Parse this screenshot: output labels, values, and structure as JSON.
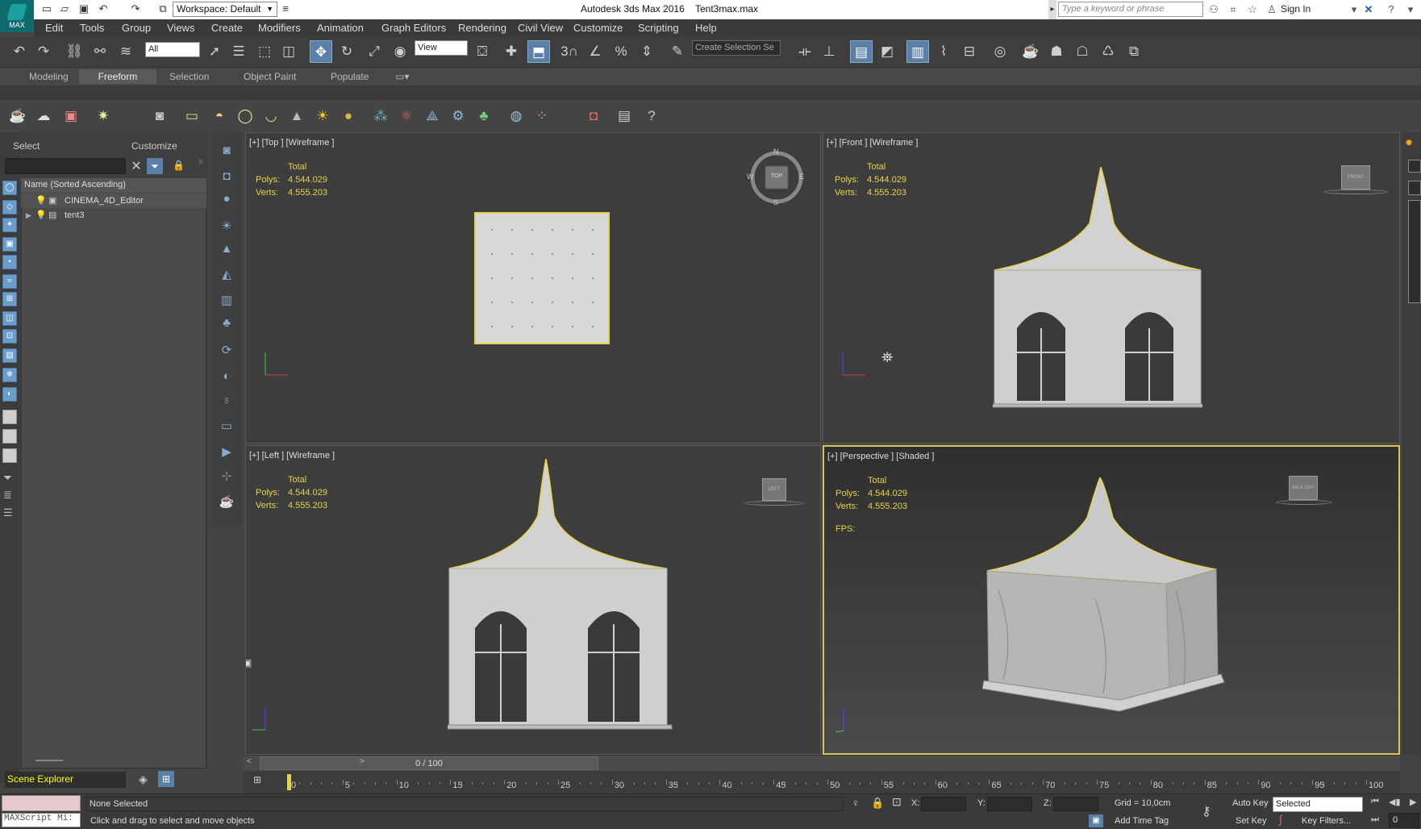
{
  "app": {
    "logo_label": "MAX",
    "title": "Autodesk 3ds Max 2016",
    "file": "Tent3max.max",
    "workspace": "Workspace: Default",
    "search_placeholder": "Type a keyword or phrase",
    "sign_in": "Sign In"
  },
  "menus": [
    "Edit",
    "Tools",
    "Group",
    "Views",
    "Create",
    "Modifiers",
    "Animation",
    "Graph Editors",
    "Rendering",
    "Civil View",
    "Customize",
    "Scripting",
    "Help"
  ],
  "toolbar": {
    "filter_value": "All",
    "refcoord_value": "View",
    "selection_set_placeholder": "Create Selection Se",
    "snap_value": "3"
  },
  "ribbon_tabs": [
    {
      "label": "Modeling",
      "active": false
    },
    {
      "label": "Freeform",
      "active": true
    },
    {
      "label": "Selection",
      "active": false
    },
    {
      "label": "Object Paint",
      "active": false
    },
    {
      "label": "Populate",
      "active": false
    }
  ],
  "scene_explorer": {
    "select_tab": "Select",
    "customize_tab": "Customize",
    "column_header": "Name (Sorted Ascending)",
    "items": [
      {
        "label": "CINEMA_4D_Editor",
        "expanded": false
      },
      {
        "label": "tent3",
        "expanded": false
      }
    ],
    "footer_label": "Scene Explorer"
  },
  "viewports": {
    "top": {
      "label": "[+] [Top ] [Wireframe ]",
      "total": "Total",
      "polys_label": "Polys:",
      "polys": "4.544.029",
      "verts_label": "Verts:",
      "verts": "4.555.203",
      "cube_label": "TOP",
      "compass": [
        "N",
        "E",
        "S",
        "W"
      ]
    },
    "front": {
      "label": "[+] [Front ] [Wireframe ]",
      "total": "Total",
      "polys_label": "Polys:",
      "polys": "4.544.029",
      "verts_label": "Verts:",
      "verts": "4.555.203",
      "cube_label": "FRONT"
    },
    "left": {
      "label": "[+] [Left ] [Wireframe ]",
      "total": "Total",
      "polys_label": "Polys:",
      "polys": "4.544.029",
      "verts_label": "Verts:",
      "verts": "4.555.203",
      "cube_label": "LEFT"
    },
    "perspective": {
      "label": "[+] [Perspective ] [Shaded ]",
      "total": "Total",
      "polys_label": "Polys:",
      "polys": "4.544.029",
      "verts_label": "Verts:",
      "verts": "4.555.203",
      "fps_label": "FPS:",
      "cube_label": "BACK LEFT"
    }
  },
  "timeline": {
    "frame_display": "0 / 100",
    "ticks": [
      "0",
      "5",
      "10",
      "15",
      "20",
      "25",
      "30",
      "35",
      "40",
      "45",
      "50",
      "55",
      "60",
      "65",
      "70",
      "75",
      "80",
      "85",
      "90",
      "95",
      "100"
    ]
  },
  "status": {
    "maxscript_placeholder": "MAXScript Mi:",
    "selection": "None Selected",
    "prompt": "Click and drag to select and move objects",
    "x_label": "X:",
    "y_label": "Y:",
    "z_label": "Z:",
    "grid": "Grid = 10,0cm",
    "add_time_tag": "Add Time Tag",
    "auto_key": "Auto Key",
    "auto_key_mode": "Selected",
    "set_key": "Set Key",
    "key_filters": "Key Filters...",
    "frame_field": "0"
  },
  "colors": {
    "selection_yellow": "#e7d34a",
    "accent_blue": "#5a7fa8",
    "viewport_bg": "#3d3d3d"
  }
}
